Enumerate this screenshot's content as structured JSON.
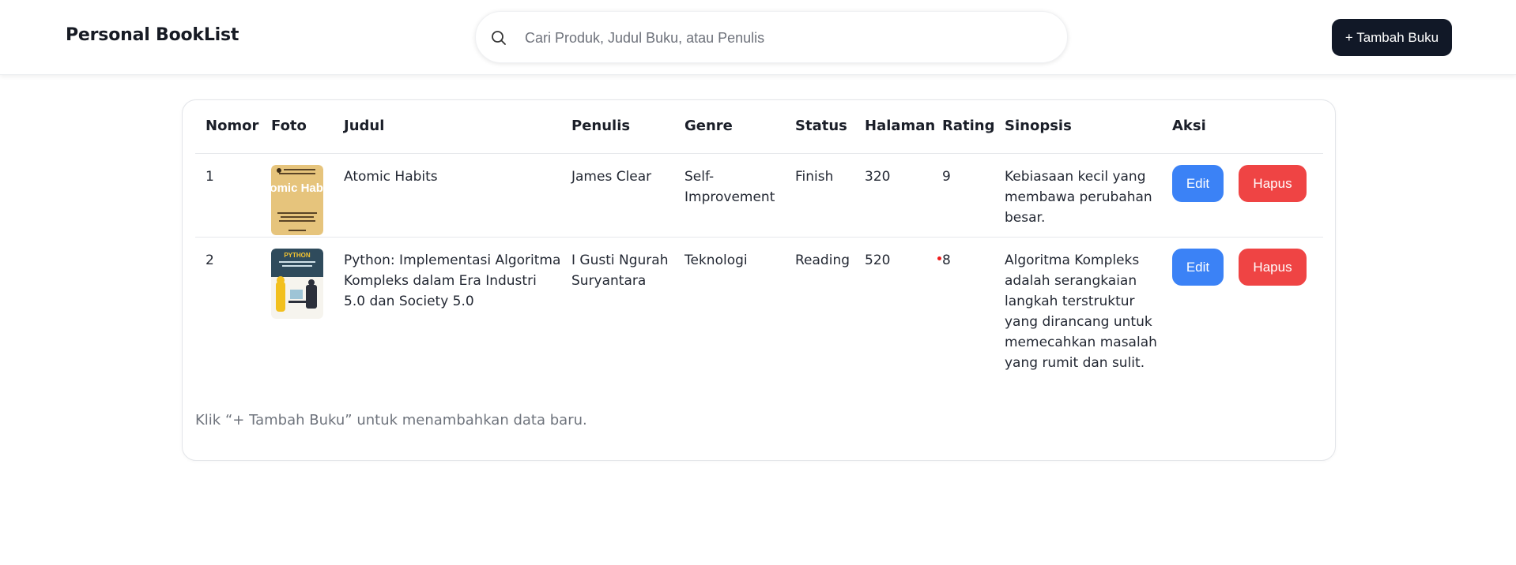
{
  "header": {
    "brand": "Personal BookList",
    "search_placeholder": "Cari Produk, Judul Buku, atau Penulis",
    "add_button": "+ Tambah Buku"
  },
  "table": {
    "columns": [
      "Nomor",
      "Foto",
      "Judul",
      "Penulis",
      "Genre",
      "Status",
      "Halaman",
      "Rating",
      "Sinopsis",
      "Aksi"
    ],
    "rows": [
      {
        "nomor": "1",
        "cover_title": "Atomic Habits",
        "judul": "Atomic Habits",
        "penulis": "James Clear",
        "genre": "Self-Improvement",
        "status": "Finish",
        "halaman": "320",
        "rating": "9",
        "sinopsis": "Kebiasaan kecil yang membawa perubahan besar.",
        "edit": "Edit",
        "hapus": "Hapus"
      },
      {
        "nomor": "2",
        "cover_title": "PYTHON",
        "judul": "Python: Implementasi Algoritma Kompleks dalam Era Industri 5.0 dan Society 5.0",
        "penulis": "I Gusti Ngurah Suryantara",
        "genre": "Teknologi",
        "status": "Reading",
        "halaman": "520",
        "rating": "8",
        "sinopsis": "Algoritma Kompleks adalah serangkaian langkah terstruktur yang dirancang untuk memecahkan masalah yang rumit dan sulit.",
        "edit": "Edit",
        "hapus": "Hapus"
      }
    ]
  },
  "footnote": "Klik “+ Tambah Buku” untuk menambahkan data baru.",
  "colors": {
    "primary_dark": "#111827",
    "edit_blue": "#3b82f6",
    "delete_red": "#ef4444"
  }
}
